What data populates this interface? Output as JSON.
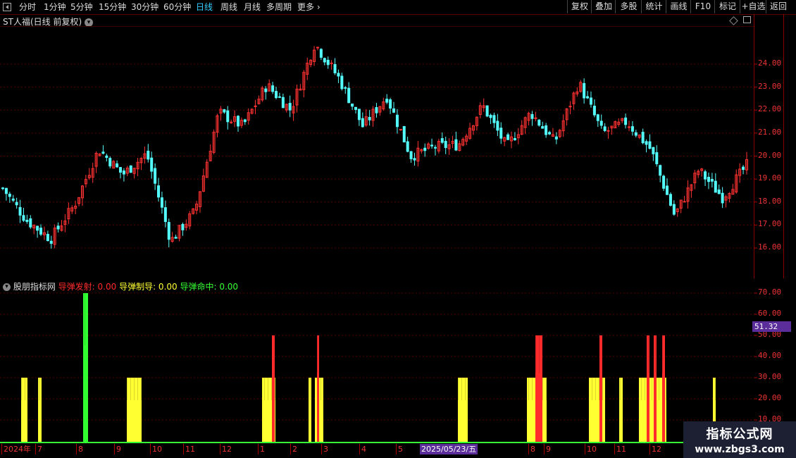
{
  "toolbar": {
    "periods": [
      "分时",
      "1分钟",
      "5分钟",
      "15分钟",
      "30分钟",
      "60分钟",
      "日线",
      "周线",
      "月线",
      "多周期",
      "更多"
    ],
    "active_period": "日线",
    "right_buttons": [
      "复权",
      "叠加",
      "多股",
      "统计",
      "画线",
      "F10",
      "标记",
      "+自选",
      "返回"
    ]
  },
  "main": {
    "title": "ST人福(日线 前复权)",
    "price_labels": [
      "24.00",
      "23.00",
      "22.00",
      "21.00",
      "20.00",
      "19.00",
      "18.00",
      "17.00",
      "16.00"
    ]
  },
  "indicator": {
    "name": "股朋指标网",
    "items": [
      {
        "label": "导弹发射: 0.00",
        "color": "#ff2b2b"
      },
      {
        "label": "导弹制导: 0.00",
        "color": "#ffff33"
      },
      {
        "label": "导弹命中: 0.00",
        "color": "#33ff33"
      }
    ],
    "scale_labels": [
      "70.00",
      "60.00",
      "50.00",
      "40.00",
      "30.00",
      "20.00",
      "10.00"
    ],
    "current_value": "51.32"
  },
  "date_axis": {
    "labels": [
      "2024年",
      "7",
      "8",
      "9",
      "10",
      "11",
      "12",
      "1",
      "2",
      "3",
      "4",
      "5",
      "2025/05/23/五",
      "8",
      "9",
      "10",
      "11",
      "12"
    ],
    "cursor_date": "2025/05/23/五"
  },
  "watermark": {
    "line1": "指标公式网",
    "line2": "www.zbgs3.com"
  },
  "colors": {
    "up": "#ff3232",
    "down": "#54ffff",
    "grid": "#5a0000",
    "guide": "#ffff33",
    "launch": "#ff2b2b",
    "hit": "#33ff33"
  },
  "chart_data": {
    "type": "candlestick",
    "title": "ST人福(日线 前复权)",
    "close_path": [
      {
        "x": "2024-06",
        "y": 18.6
      },
      {
        "x": "2024-06-15",
        "y": 17.2
      },
      {
        "x": "2024-07-01",
        "y": 16.4
      },
      {
        "x": "2024-07-20",
        "y": 17.9
      },
      {
        "x": "2024-08-05",
        "y": 20.3
      },
      {
        "x": "2024-08-25",
        "y": 19.2
      },
      {
        "x": "2024-09-05",
        "y": 20.1
      },
      {
        "x": "2024-09-15",
        "y": 16.3
      },
      {
        "x": "2024-09-25",
        "y": 17.6
      },
      {
        "x": "2024-10-08",
        "y": 21.9
      },
      {
        "x": "2024-10-25",
        "y": 21.3
      },
      {
        "x": "2024-11-10",
        "y": 23.1
      },
      {
        "x": "2024-11-25",
        "y": 22.0
      },
      {
        "x": "2024-12-10",
        "y": 24.9
      },
      {
        "x": "2024-12-25",
        "y": 23.4
      },
      {
        "x": "2025-01-10",
        "y": 21.3
      },
      {
        "x": "2025-01-25",
        "y": 22.6
      },
      {
        "x": "2025-02-15",
        "y": 20.0
      },
      {
        "x": "2025-03-10",
        "y": 20.4
      },
      {
        "x": "2025-04-10",
        "y": 20.5
      },
      {
        "x": "2025-05-10",
        "y": 22.2
      },
      {
        "x": "2025-05-30",
        "y": 20.4
      },
      {
        "x": "2025-06-20",
        "y": 21.9
      },
      {
        "x": "2025-07-20",
        "y": 20.6
      },
      {
        "x": "2025-08-10",
        "y": 23.2
      },
      {
        "x": "2025-08-25",
        "y": 21.0
      },
      {
        "x": "2025-09-20",
        "y": 21.5
      },
      {
        "x": "2025-10-10",
        "y": 20.3
      },
      {
        "x": "2025-11-01",
        "y": 17.4
      },
      {
        "x": "2025-11-10",
        "y": 19.4
      },
      {
        "x": "2025-11-30",
        "y": 18.2
      },
      {
        "x": "2025-12-15",
        "y": 19.6
      }
    ],
    "indicator_bars": {
      "guide": [
        [
          30,
          38,
          30
        ],
        [
          54,
          58,
          30
        ],
        [
          180,
          200,
          30
        ],
        [
          372,
          390,
          30
        ],
        [
          438,
          441,
          30
        ],
        [
          447,
          458,
          30
        ],
        [
          650,
          663,
          30
        ],
        [
          748,
          775,
          30
        ],
        [
          836,
          858,
          30
        ],
        [
          879,
          883,
          30
        ],
        [
          907,
          945,
          30
        ],
        [
          1012,
          1015,
          30
        ]
      ],
      "launch": [
        [
          386,
          389,
          50
        ],
        [
          450,
          452,
          50
        ],
        [
          760,
          769,
          50
        ],
        [
          851,
          854,
          50
        ],
        [
          918,
          921,
          50
        ],
        [
          928,
          931,
          50
        ],
        [
          940,
          943,
          50
        ]
      ],
      "hit": [
        [
          118,
          124,
          70
        ]
      ]
    },
    "ylim": [
      15.2,
      25.6
    ],
    "indicator_ylim": [
      0,
      75
    ]
  }
}
